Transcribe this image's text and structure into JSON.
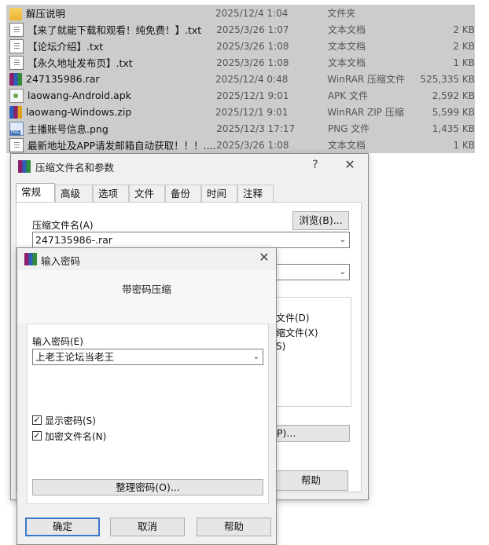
{
  "file_list": [
    {
      "name": "解压说明",
      "date": "2025/12/4 1:04",
      "type": "文件夹",
      "size": "",
      "icon": "folder-icon"
    },
    {
      "name": "【来了就能下载和观看！纯免费！】.txt",
      "date": "2025/3/26 1:07",
      "type": "文本文档",
      "size": "2 KB",
      "icon": "text-file-icon"
    },
    {
      "name": "【论坛介绍】.txt",
      "date": "2025/3/26 1:08",
      "type": "文本文档",
      "size": "2 KB",
      "icon": "text-file-icon"
    },
    {
      "name": "【永久地址发布页】.txt",
      "date": "2025/3/26 1:08",
      "type": "文本文档",
      "size": "1 KB",
      "icon": "text-file-icon"
    },
    {
      "name": "247135986.rar",
      "date": "2025/12/4 0:48",
      "type": "WinRAR 压缩文件",
      "size": "525,335 KB",
      "icon": "rar-archive-icon"
    },
    {
      "name": "laowang-Android.apk",
      "date": "2025/12/1 9:01",
      "type": "APK 文件",
      "size": "2,592 KB",
      "icon": "apk-file-icon"
    },
    {
      "name": "laowang-Windows.zip",
      "date": "2025/12/1 9:01",
      "type": "WinRAR ZIP 压缩...",
      "size": "5,599 KB",
      "icon": "zip-archive-icon"
    },
    {
      "name": "主播账号信息.png",
      "date": "2025/12/3 17:17",
      "type": "PNG 文件",
      "size": "1,435 KB",
      "icon": "png-image-icon"
    },
    {
      "name": "最新地址及APP请发邮箱自动获取！！！....",
      "date": "2025/3/26 1:08",
      "type": "文本文档",
      "size": "1 KB",
      "icon": "text-file-icon"
    }
  ],
  "archive_dialog": {
    "title": "压缩文件名和参数",
    "help_glyph": "?",
    "close_glyph": "✕",
    "tabs": [
      "常规",
      "高级",
      "选项",
      "文件",
      "备份",
      "时间",
      "注释"
    ],
    "archive_name_label": "压缩文件名(A)",
    "browse_label": "浏览(B)...",
    "archive_name_value": "247135986-.rar",
    "partial_option_1": "文件(D)",
    "partial_option_2": "缩文件(X)",
    "partial_option_3": "S)",
    "partial_button": "P)...",
    "help_label": "帮助"
  },
  "password_dialog": {
    "title": "输入密码",
    "close_glyph": "✕",
    "header": "带密码压缩",
    "password_label": "输入密码(E)",
    "password_value": "上老王论坛当老王",
    "show_password_label": "显示密码(S)",
    "show_password_checked": true,
    "encrypt_names_label": "加密文件名(N)",
    "encrypt_names_checked": true,
    "organize_label": "整理密码(O)...",
    "ok_label": "确定",
    "cancel_label": "取消",
    "help_label": "帮助"
  },
  "colors": {
    "selection": "#cccccc",
    "dialog_bg": "#f0f0f0",
    "focus_border": "#3a78c9"
  }
}
